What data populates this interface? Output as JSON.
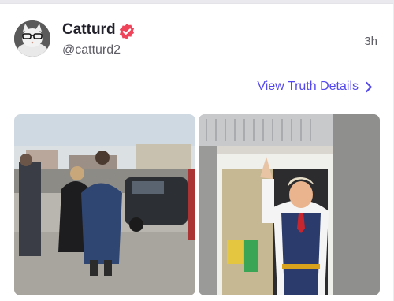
{
  "post": {
    "display_name": "Catturd",
    "handle": "@catturd2",
    "time_ago": "3h",
    "verified_icon": "verified-badge-icon",
    "verified_color": "#f0445b",
    "details_link": "View Truth Details",
    "details_icon": "chevron-right-icon",
    "accent_color": "#5448ee"
  },
  "media": [
    {
      "icon": "photo-people-walking-parking-lot"
    },
    {
      "icon": "photo-man-waving-drive-thru-window"
    }
  ]
}
